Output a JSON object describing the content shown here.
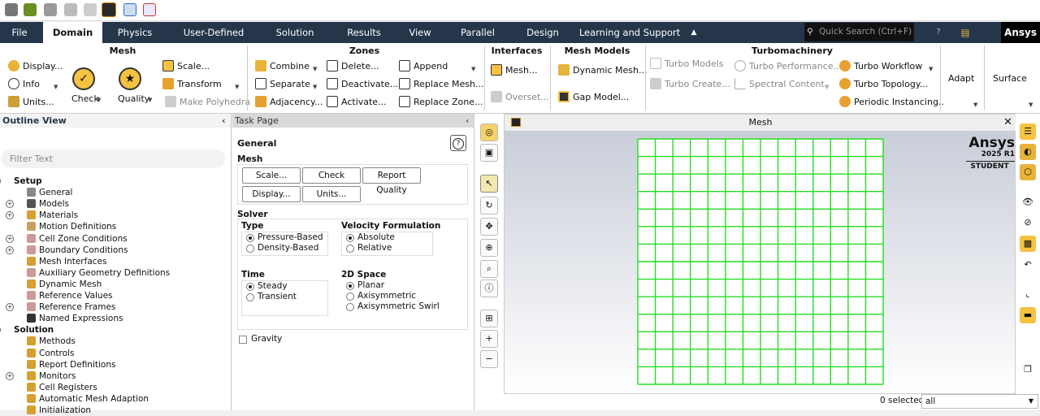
{
  "menubar": {
    "tabs": [
      "File",
      "Domain",
      "Physics",
      "User-Defined",
      "Solution",
      "Results",
      "View",
      "Parallel",
      "Design",
      "Learning and Support"
    ],
    "active": "Domain",
    "search_placeholder": "Quick Search (Ctrl+F)",
    "brand": "Ansys"
  },
  "ribbon": {
    "mesh": {
      "title": "Mesh",
      "display": "Display...",
      "info": "Info",
      "units": "Units...",
      "check": "Check",
      "quality": "Quality",
      "scale": "Scale...",
      "transform": "Transform",
      "make_polyhedra": "Make Polyhedra"
    },
    "zones": {
      "title": "Zones",
      "combine": "Combine",
      "separate": "Separate",
      "adjacency": "Adjacency...",
      "delete": "Delete...",
      "deactivate": "Deactivate...",
      "activate": "Activate...",
      "append": "Append",
      "replace_mesh": "Replace Mesh...",
      "replace_zone": "Replace Zone..."
    },
    "interfaces": {
      "title": "Interfaces",
      "mesh": "Mesh...",
      "overset": "Overset..."
    },
    "mesh_models": {
      "title": "Mesh Models",
      "dynamic_mesh": "Dynamic Mesh...",
      "gap_model": "Gap Model..."
    },
    "turbomachinery": {
      "title": "Turbomachinery",
      "turbo_models": "Turbo Models",
      "turbo_create": "Turbo Create...",
      "turbo_performance": "Turbo Performance...",
      "spectral_content": "Spectral Content",
      "turbo_workflow": "Turbo Workflow",
      "turbo_topology": "Turbo Topology...",
      "periodic_instancing": "Periodic Instancing.."
    },
    "adapt": "Adapt",
    "surface": "Surface"
  },
  "outline": {
    "title": "Outline View",
    "filter_placeholder": "Filter Text",
    "setup": "Setup",
    "setup_items": [
      "General",
      "Models",
      "Materials",
      "Motion Definitions",
      "Cell Zone Conditions",
      "Boundary Conditions",
      "Mesh Interfaces",
      "Auxiliary Geometry Definitions",
      "Dynamic Mesh",
      "Reference Values",
      "Reference Frames",
      "Named Expressions"
    ],
    "solution": "Solution",
    "solution_items": [
      "Methods",
      "Controls",
      "Report Definitions",
      "Monitors",
      "Cell Registers",
      "Automatic Mesh Adaption",
      "Initialization"
    ]
  },
  "task": {
    "title": "Task Page",
    "heading": "General",
    "help": "?",
    "mesh_section": "Mesh",
    "scale": "Scale...",
    "check": "Check",
    "report_quality": "Report Quality",
    "display": "Display...",
    "units": "Units...",
    "solver_section": "Solver",
    "type_label": "Type",
    "type_options": [
      "Pressure-Based",
      "Density-Based"
    ],
    "type_selected": "Pressure-Based",
    "velocity_label": "Velocity Formulation",
    "velocity_options": [
      "Absolute",
      "Relative"
    ],
    "velocity_selected": "Absolute",
    "time_label": "Time",
    "time_options": [
      "Steady",
      "Transient"
    ],
    "time_selected": "Steady",
    "space_label": "2D Space",
    "space_options": [
      "Planar",
      "Axisymmetric",
      "Axisymmetric Swirl"
    ],
    "space_selected": "Planar",
    "gravity": "Gravity"
  },
  "viewport": {
    "title": "Mesh",
    "logo_brand": "Ansys",
    "logo_version": "2025 R1",
    "logo_edition": "STUDENT",
    "mesh_color": "#22dd22"
  },
  "status": {
    "selected": "0 selected",
    "filter_value": "all"
  }
}
